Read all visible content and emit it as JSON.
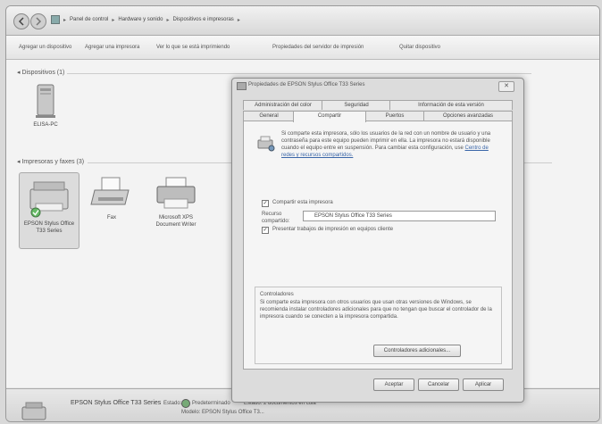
{
  "breadcrumb": [
    "Panel de control",
    "Hardware y sonido",
    "Dispositivos e impresoras"
  ],
  "commands": [
    "Agregar un dispositivo",
    "Agregar una impresora",
    "Ver lo que se está imprimiendo",
    "Propiedades del servidor de impresión",
    "Quitar dispositivo"
  ],
  "sections": {
    "devices": "Dispositivos (1)",
    "printers": "Impresoras y faxes (3)"
  },
  "devices": [
    {
      "label": "ELISA-PC"
    }
  ],
  "printers": [
    {
      "label": "EPSON Stylus Office T33 Series"
    },
    {
      "label": "Fax"
    },
    {
      "label": "Microsoft XPS Document Writer"
    }
  ],
  "status_bar": {
    "name": "EPSON Stylus Office T33 Series",
    "estado_label": "Estado:",
    "estado_value": "Predeterminado",
    "estado2": "Estado: 2 documentos en cola",
    "modelo": "Modelo: EPSON Stylus Office T3..."
  },
  "dialog": {
    "title": "Propiedades de EPSON Stylus Office T33 Series",
    "close": "✕",
    "tabs_back": [
      "Administración del color",
      "Seguridad",
      "Información de esta versión"
    ],
    "tabs_front": [
      "General",
      "Compartir",
      "Puertos",
      "Opciones avanzadas"
    ],
    "info_text": "Si comparte esta impresora, sólo los usuarios de la red con un nombre de usuario y una contraseña para este equipo pueden imprimir en ella. La impresora no estará disponible cuando el equipo entre en suspensión. Para cambiar esta configuración, use",
    "info_link": "Centro de redes y recursos compartidos.",
    "share_checkbox": "Compartir esta impresora",
    "share_name_label": "Recurso compartido:",
    "share_name_value": "EPSON Stylus Office T33 Series",
    "render_checkbox": "Presentar trabajos de impresión en equipos cliente",
    "drivers_title": "Controladores",
    "drivers_text": "Si comparte esta impresora con otros usuarios que usan otras versiones de Windows, se recomienda instalar controladores adicionales para que no tengan que buscar el controlador de la impresora cuando se conecten a la impresora compartida.",
    "drivers_button": "Controladores adicionales...",
    "ok": "Aceptar",
    "cancel": "Cancelar",
    "apply": "Aplicar"
  }
}
